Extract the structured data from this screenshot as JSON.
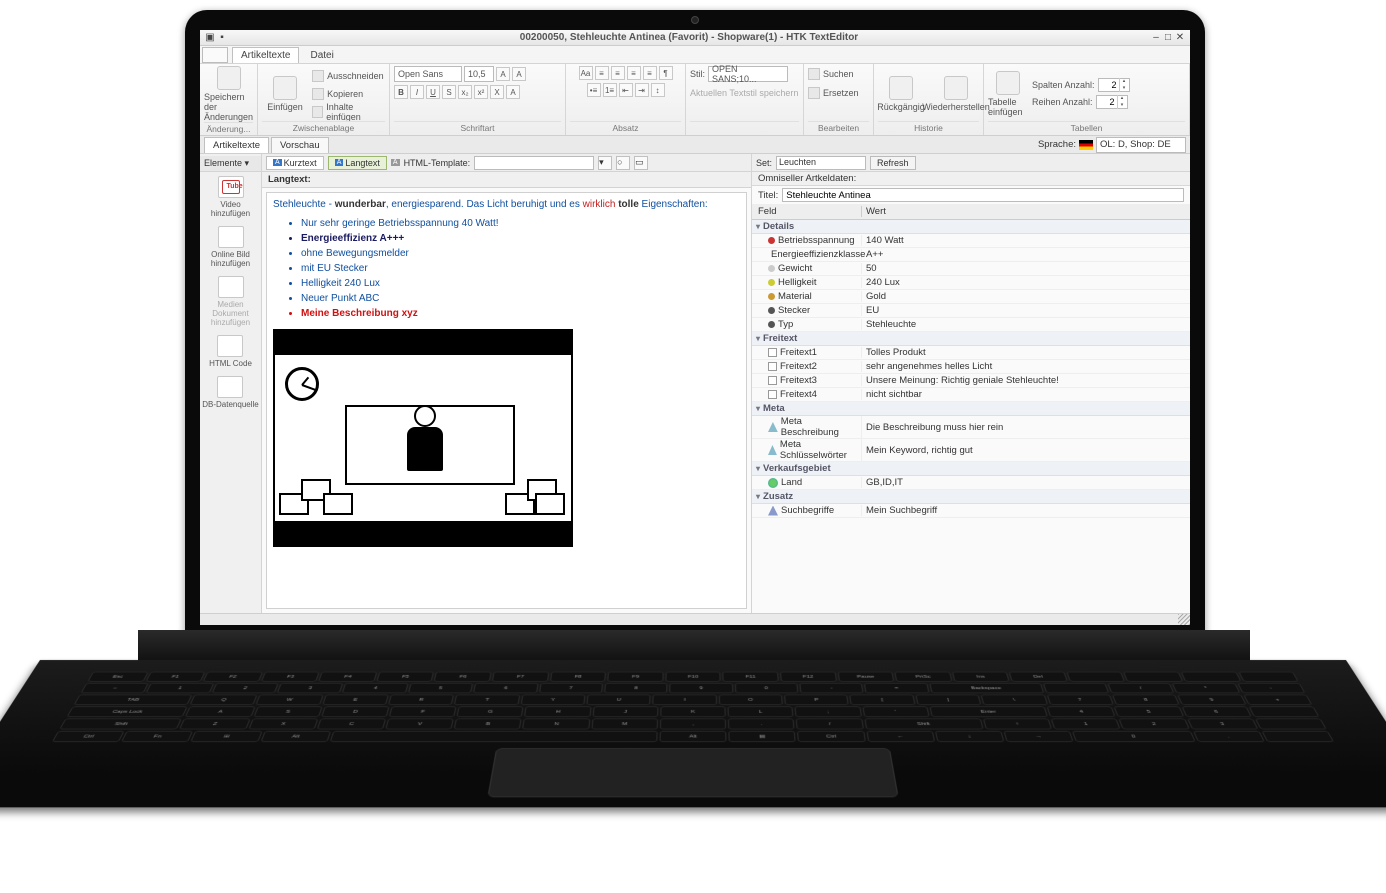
{
  "window": {
    "title": "00200050, Stehleuchte Antinea (Favorit) - Shopware(1) - HTK TextEditor"
  },
  "menu": {
    "tab_artikeltexte": "Artikeltexte",
    "tab_datei": "Datei"
  },
  "ribbon": {
    "save": {
      "label": "Speichern der Änderungen",
      "group": "Änderung..."
    },
    "paste": {
      "label": "Einfügen"
    },
    "cut": "Ausschneiden",
    "copy": "Kopieren",
    "pastecontent": "Inhalte einfügen",
    "clipboard_group": "Zwischenablage",
    "font_name": "Open Sans",
    "font_size": "10,5",
    "font_group": "Schriftart",
    "paragraph_group": "Absatz",
    "style_label": "Stil:",
    "style_value": "OPEN SANS;10...",
    "style_save": "Aktuellen Textstil speichern",
    "search": "Suchen",
    "replace": "Ersetzen",
    "edit_group": "Bearbeiten",
    "undo": "Rückgängig",
    "redo": "Wiederherstellen",
    "history_group": "Historie",
    "table_insert": "Tabelle einfügen",
    "cols_label": "Spalten Anzahl:",
    "cols_value": "2",
    "rows_label": "Reihen Anzahl:",
    "rows_value": "2",
    "tables_group": "Tabellen"
  },
  "maintabs": {
    "artikeltexte": "Artikeltexte",
    "vorschau": "Vorschau",
    "sprache_label": "Sprache:",
    "sprache_value": "OL: D, Shop: DE"
  },
  "sidebar": {
    "header": "Elemente",
    "items": [
      {
        "label": "Video hinzufügen"
      },
      {
        "label": "Online Bild hinzufügen"
      },
      {
        "label": "Medien Dokument hinzufügen"
      },
      {
        "label": "HTML Code"
      },
      {
        "label": "DB-Datenquelle"
      }
    ]
  },
  "subtool": {
    "kurztext": "Kurztext",
    "langtext": "Langtext",
    "htmltemplate": "HTML-Template:"
  },
  "editor": {
    "header": "Langtext:",
    "intro_part1": "Stehleuchte - ",
    "intro_bold": "wunderbar",
    "intro_part2": ", energiesparend. Das Licht beruhigt und es ",
    "intro_red": "wirklich",
    "intro_part3": " tolle ",
    "intro_part4": "Eigenschaften:",
    "bullets": [
      "Nur sehr geringe Betriebsspannung 40 Watt!",
      "Energieeffizienz A+++",
      "ohne Bewegungsmelder",
      "mit EU Stecker",
      "Helligkeit 240 Lux",
      "Neuer Punkt ABC",
      "Meine Beschreibung xyz"
    ]
  },
  "rightpanel": {
    "set_label": "Set:",
    "set_value": "Leuchten",
    "refresh": "Refresh",
    "header": "Omniseller Artkeldaten:",
    "titel_label": "Titel:",
    "titel_value": "Stehleuchte Antinea",
    "col_field": "Feld",
    "col_value": "Wert",
    "sections": {
      "details": "Details",
      "freitext": "Freitext",
      "meta": "Meta",
      "verkauf": "Verkaufsgebiet",
      "zusatz": "Zusatz"
    },
    "details": [
      {
        "k": "Betriebsspannung",
        "v": "140 Watt",
        "c": "#c33"
      },
      {
        "k": "Energieeffizienzklasse",
        "v": "A++",
        "c": "#37c"
      },
      {
        "k": "Gewicht",
        "v": "50",
        "c": "#ccc"
      },
      {
        "k": "Helligkeit",
        "v": "240 Lux",
        "c": "#cc3"
      },
      {
        "k": "Material",
        "v": "Gold",
        "c": "#c93"
      },
      {
        "k": "Stecker",
        "v": "EU",
        "c": "#555"
      },
      {
        "k": "Typ",
        "v": "Stehleuchte",
        "c": "#555"
      }
    ],
    "freitext": [
      {
        "k": "Freitext1",
        "v": "Tolles Produkt"
      },
      {
        "k": "Freitext2",
        "v": "sehr angenehmes helles Licht"
      },
      {
        "k": "Freitext3",
        "v": "Unsere Meinung: Richtig geniale Stehleuchte!"
      },
      {
        "k": "Freitext4",
        "v": "nicht sichtbar"
      }
    ],
    "meta": [
      {
        "k": "Meta Beschreibung",
        "v": "Die Beschreibung muss hier rein"
      },
      {
        "k": "Meta Schlüsselwörter",
        "v": "Mein Keyword, richtig gut"
      }
    ],
    "verkauf": [
      {
        "k": "Land",
        "v": "GB,ID,IT"
      }
    ],
    "zusatz": [
      {
        "k": "Suchbegriffe",
        "v": "Mein Suchbegriff"
      }
    ]
  }
}
